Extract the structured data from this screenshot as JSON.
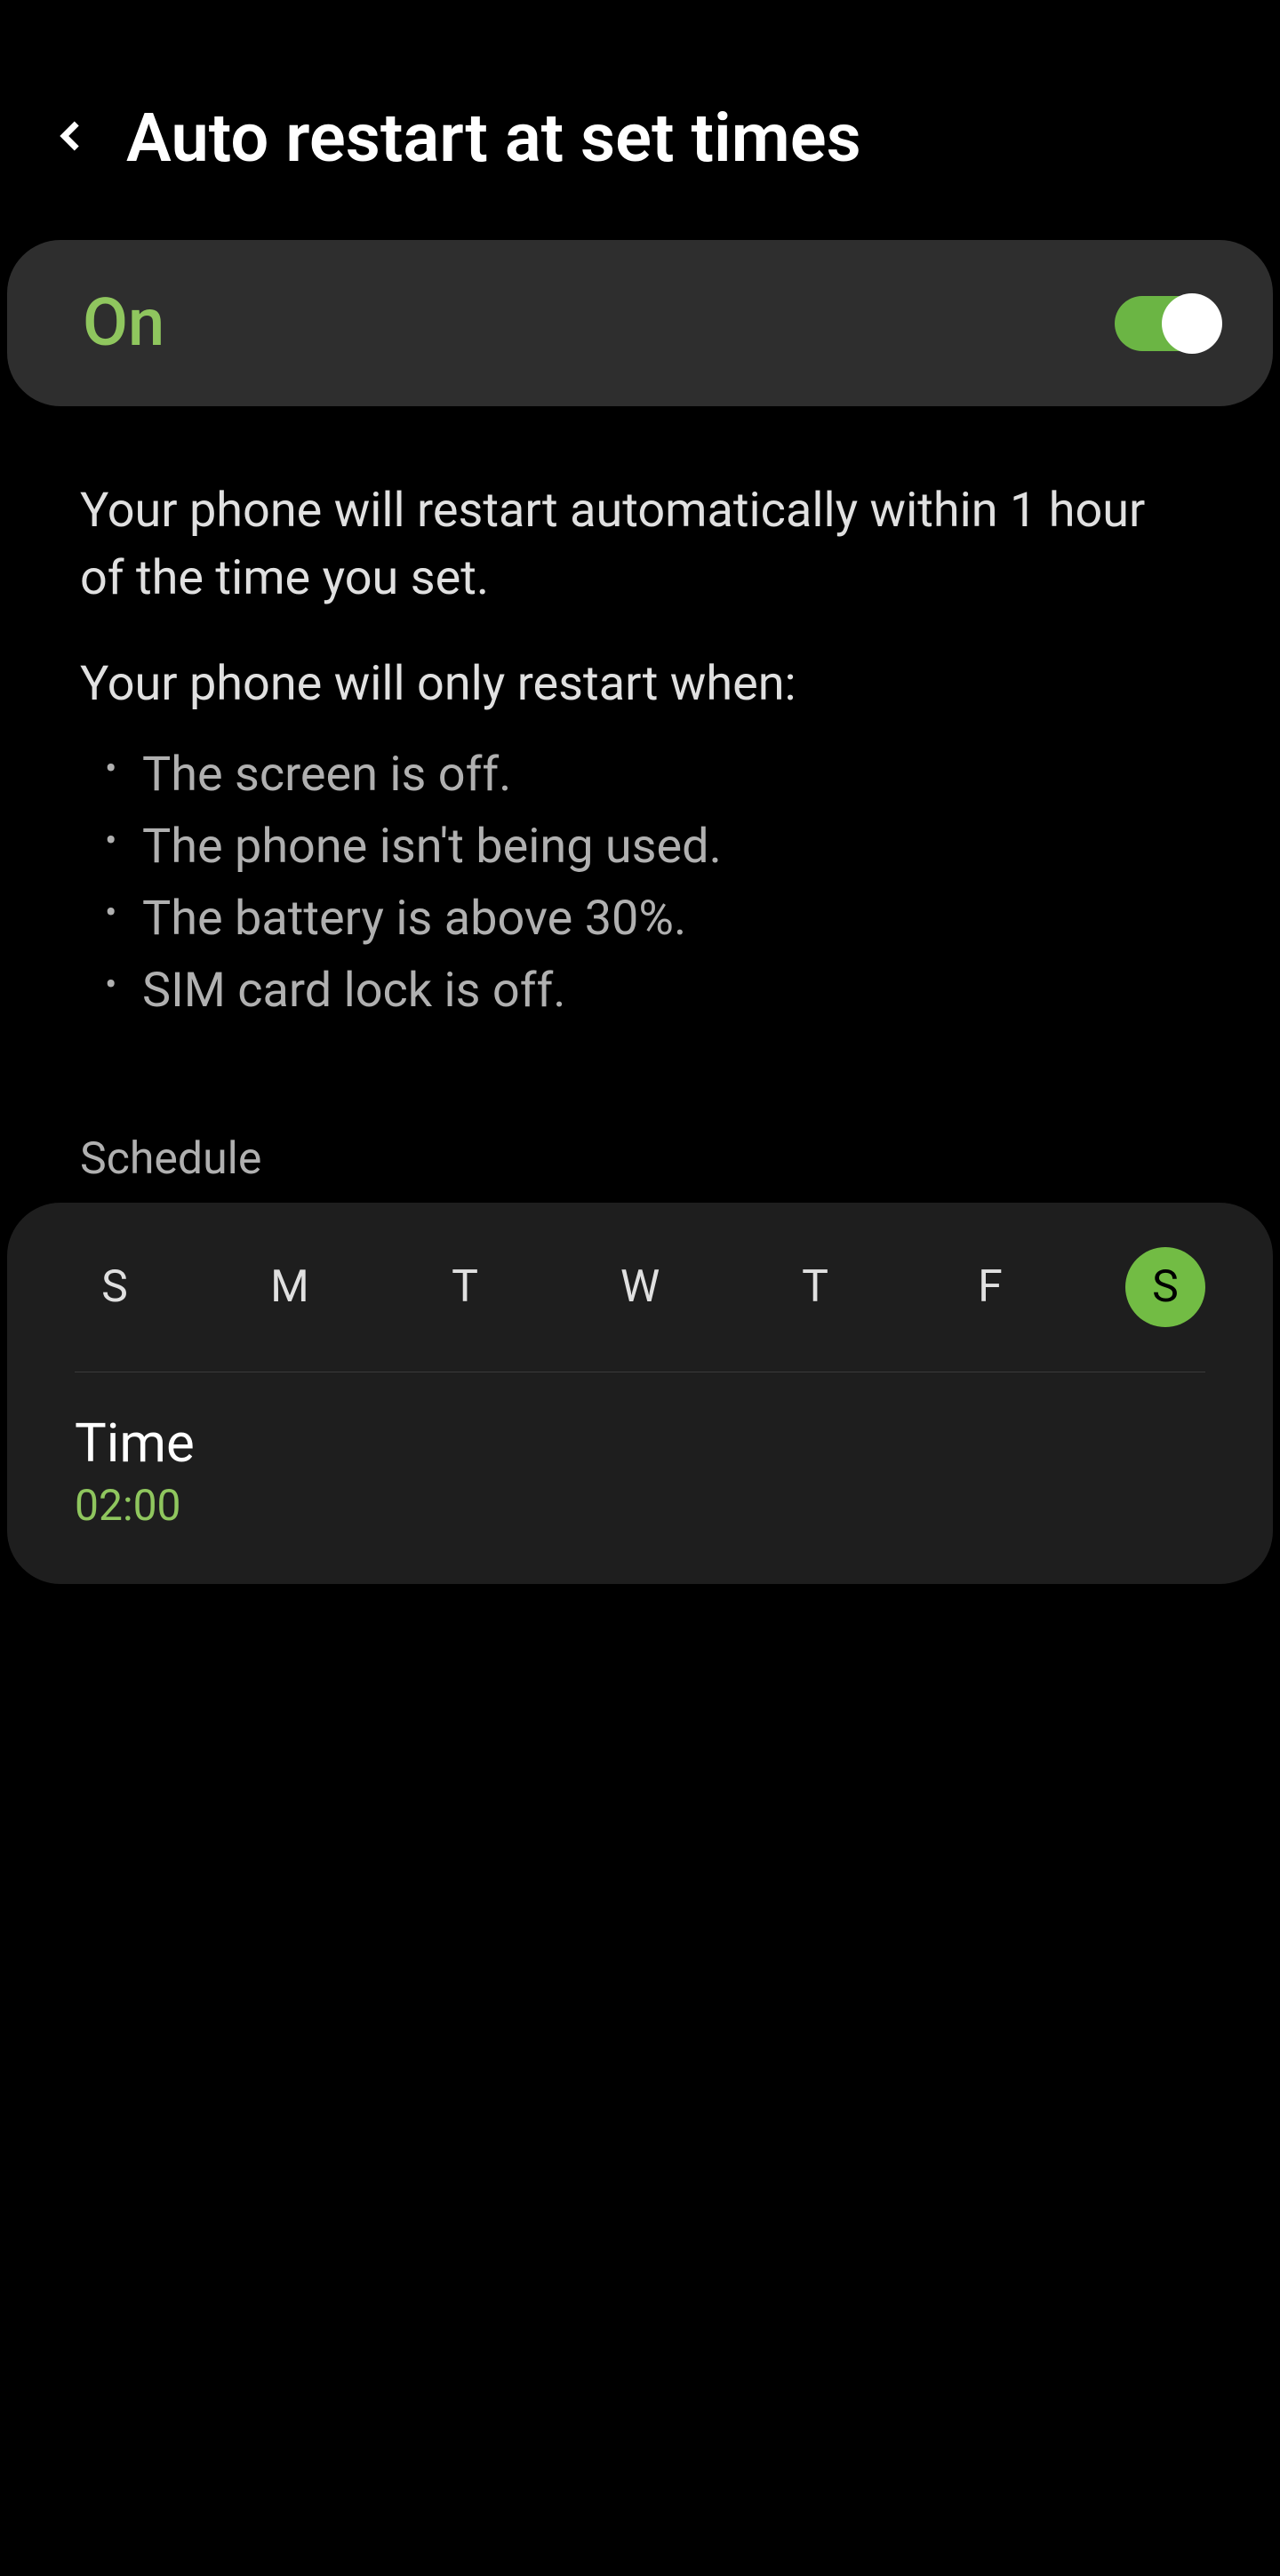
{
  "header": {
    "title": "Auto restart at set times"
  },
  "toggle": {
    "label": "On",
    "state": "on"
  },
  "description": {
    "main": "Your phone will restart automatically within 1 hour of the time you set.",
    "conditionsIntro": "Your phone will only restart when:",
    "conditions": [
      "The screen is off.",
      "The phone isn't being used.",
      "The battery is above 30%.",
      "SIM card lock is off."
    ]
  },
  "schedule": {
    "sectionLabel": "Schedule",
    "days": [
      {
        "label": "S",
        "selected": false
      },
      {
        "label": "M",
        "selected": false
      },
      {
        "label": "T",
        "selected": false
      },
      {
        "label": "W",
        "selected": false
      },
      {
        "label": "T",
        "selected": false
      },
      {
        "label": "F",
        "selected": false
      },
      {
        "label": "S",
        "selected": true
      }
    ],
    "timeLabel": "Time",
    "timeValue": "02:00"
  }
}
